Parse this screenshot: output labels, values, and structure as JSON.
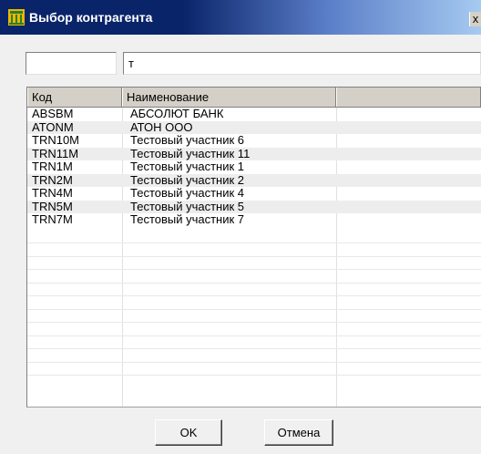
{
  "window": {
    "title": "Выбор контрагента",
    "close_label": "x"
  },
  "filters": {
    "code_value": "",
    "name_value": "т"
  },
  "table": {
    "columns": [
      "Код",
      "Наименование",
      ""
    ],
    "rows": [
      {
        "code": "ABSBM",
        "name": "АБСОЛЮТ БАНК"
      },
      {
        "code": "ATONM",
        "name": "АТОН ООО"
      },
      {
        "code": "TRN10M",
        "name": "Тестовый участник 6"
      },
      {
        "code": "TRN11M",
        "name": "Тестовый участник 11"
      },
      {
        "code": "TRN1M",
        "name": "Тестовый участник 1"
      },
      {
        "code": "TRN2M",
        "name": "Тестовый участник 2"
      },
      {
        "code": "TRN4M",
        "name": "Тестовый участник 4"
      },
      {
        "code": "TRN5M",
        "name": "Тестовый участник 5"
      },
      {
        "code": "TRN7M",
        "name": "Тестовый участник 7"
      }
    ]
  },
  "buttons": {
    "ok_label": "OK",
    "cancel_label": "Отмена"
  },
  "colors": {
    "titlebar_start": "#0a246a",
    "titlebar_end": "#a6caf0",
    "dialog_bg": "#f0f0f0",
    "alt_row": "#ededed"
  }
}
